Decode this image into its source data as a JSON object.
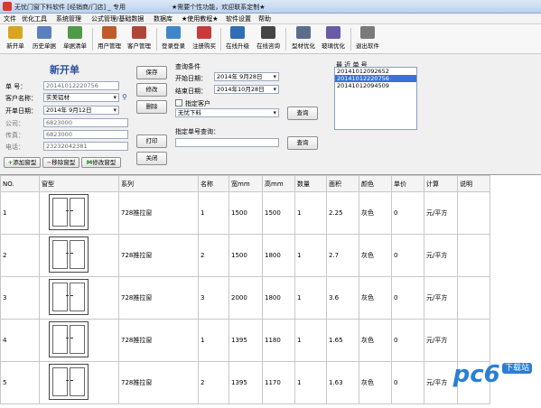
{
  "window": {
    "title": "无忧门窗下料软件 [经销商/门店] _ 专用",
    "notice": "★需要个性功能，欢迎联系定制★"
  },
  "menu": [
    "文件",
    "优化工具",
    "系统管理",
    "公式管理/基础数据",
    "数据库",
    "★使用教程★",
    "软件设置",
    "帮助"
  ],
  "toolbar": [
    {
      "label": "新开单",
      "icon": "new-order-icon",
      "color": "#d9a520"
    },
    {
      "label": "历史单据",
      "icon": "history-icon",
      "color": "#5b7fbf"
    },
    {
      "label": "单据清单",
      "icon": "list-icon",
      "color": "#4f9a46"
    },
    {
      "label": "用户管理",
      "icon": "user-icon",
      "color": "#c05a2a"
    },
    {
      "label": "客户管理",
      "icon": "customer-icon",
      "color": "#b0463a"
    },
    {
      "label": "登录登录",
      "icon": "login-icon",
      "color": "#3e86c8"
    },
    {
      "label": "注册购买",
      "icon": "register-icon",
      "color": "#c93a3a"
    },
    {
      "label": "在线升级",
      "icon": "upgrade-icon",
      "color": "#2f6db5"
    },
    {
      "label": "在线咨询",
      "icon": "consult-icon",
      "color": "#444444"
    },
    {
      "label": "型材优化",
      "icon": "profile-optimize-icon",
      "color": "#5a6e8c"
    },
    {
      "label": "玻璃优化",
      "icon": "glass-optimize-icon",
      "color": "#6a5aa8"
    },
    {
      "label": "退出软件",
      "icon": "exit-icon",
      "color": "#7a7a7a"
    }
  ],
  "form": {
    "heading": "新开单",
    "order_no_label": "单 号：",
    "order_no_value": "20141012220756",
    "customer_label": "客户名称：",
    "customer_value": "实美铝材",
    "date_label": "开单日期：",
    "date_value": "2014年 9月12日",
    "company_label": "公司：",
    "company_value": "6823000",
    "fax_label": "传真：",
    "fax_value": "6823000",
    "phone_label": "电话：",
    "phone_value": "23232042381"
  },
  "buttons": {
    "save": "保存",
    "modify": "修改",
    "delete": "删除",
    "print": "打印",
    "close": "关闭",
    "add_window": "添加窗型",
    "remove_window": "移除窗型",
    "edit_window": "修改窗型"
  },
  "query": {
    "title": "查询条件",
    "start_label": "开始日期：",
    "start_value": "2014年 9月28日",
    "end_label": "结束日期：",
    "end_value": "2014年10月28日",
    "specify_customer_label": "指定客户",
    "customer_select": "无忧下料",
    "query_button": "查询",
    "order_query_label": "指定单号查询：",
    "order_query_value": "",
    "query_button2": "查询"
  },
  "recent": {
    "title": "最 近 单 号",
    "items": [
      "20141012092652",
      "20141012220756",
      "20141012094509"
    ],
    "selected_index": 1
  },
  "table": {
    "columns": [
      "NO.",
      "窗型",
      "系列",
      "名称",
      "宽mm",
      "高mm",
      "数量",
      "面积",
      "颜色",
      "单价",
      "计算",
      "说明"
    ],
    "rows": [
      {
        "no": "1",
        "series": "728推拉窗",
        "name": "1",
        "width": "1500",
        "height": "1500",
        "qty": "1",
        "area": "2.25",
        "color": "灰色",
        "price": "0",
        "calc": "元/平方",
        "note": ""
      },
      {
        "no": "2",
        "series": "728推拉窗",
        "name": "2",
        "width": "1500",
        "height": "1800",
        "qty": "1",
        "area": "2.7",
        "color": "灰色",
        "price": "0",
        "calc": "元/平方",
        "note": ""
      },
      {
        "no": "3",
        "series": "728推拉窗",
        "name": "3",
        "width": "2000",
        "height": "1800",
        "qty": "1",
        "area": "3.6",
        "color": "灰色",
        "price": "0",
        "calc": "元/平方",
        "note": ""
      },
      {
        "no": "4",
        "series": "728推拉窗",
        "name": "1",
        "width": "1395",
        "height": "1180",
        "qty": "1",
        "area": "1.65",
        "color": "灰色",
        "price": "0",
        "calc": "元/平方",
        "note": ""
      },
      {
        "no": "5",
        "series": "728推拉窗",
        "name": "2",
        "width": "1395",
        "height": "1170",
        "qty": "1",
        "area": "1.63",
        "color": "灰色",
        "price": "0",
        "calc": "元/平方",
        "note": ""
      }
    ]
  },
  "watermark": {
    "text": "pc6",
    "sub": "下载站",
    "color": "#2a7fd4"
  }
}
